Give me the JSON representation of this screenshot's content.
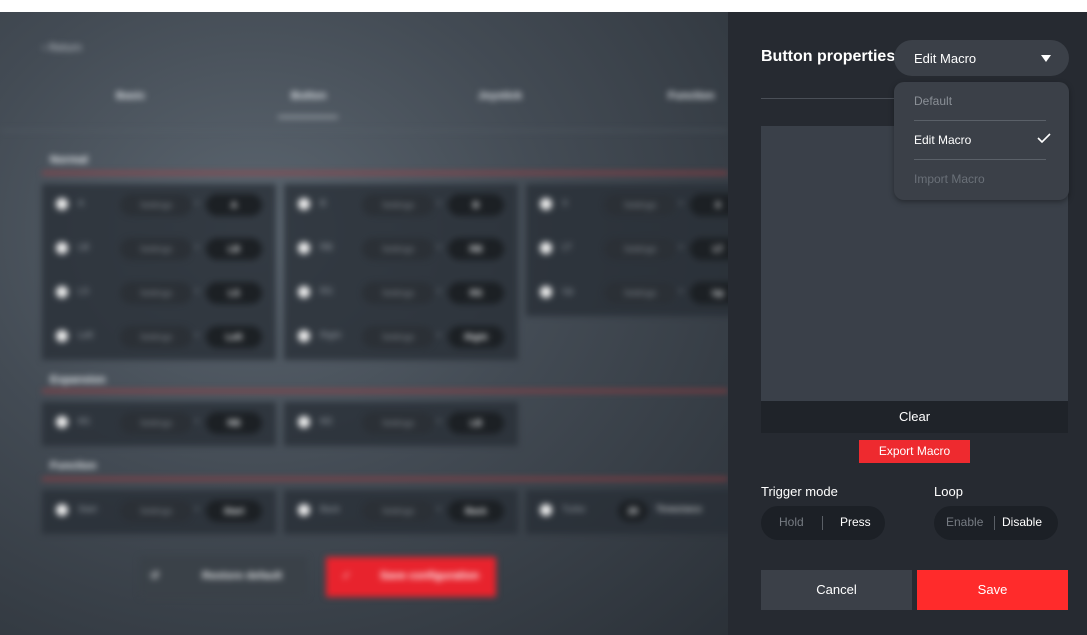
{
  "background": {
    "return_label": "Return",
    "tabs": [
      "Basic",
      "Button",
      "Joystick",
      "Function"
    ],
    "sections": {
      "normal": "Normal",
      "expansion": "Expansion",
      "function": "Function"
    },
    "rows": {
      "normal_col1": [
        {
          "name": "A",
          "setting": "Settings",
          "value": "A"
        },
        {
          "name": "LB",
          "setting": "Settings",
          "value": "LB"
        },
        {
          "name": "LS",
          "setting": "Settings",
          "value": "LS"
        },
        {
          "name": "Left",
          "setting": "Settings",
          "value": "Left"
        }
      ],
      "normal_col2": [
        {
          "name": "B",
          "setting": "Settings",
          "value": "B"
        },
        {
          "name": "RB",
          "setting": "Settings",
          "value": "RB"
        },
        {
          "name": "RS",
          "setting": "Settings",
          "value": "RS"
        },
        {
          "name": "Right",
          "setting": "Settings",
          "value": "Right"
        }
      ],
      "normal_col3": [
        {
          "name": "X",
          "setting": "Settings",
          "value": "X"
        },
        {
          "name": "LT",
          "setting": "Settings",
          "value": "LT"
        },
        {
          "name": "Up",
          "setting": "Settings",
          "value": "Up"
        }
      ],
      "expansion": [
        {
          "name": "M1",
          "setting": "Settings",
          "value": "RB"
        },
        {
          "name": "M2",
          "setting": "Settings",
          "value": "LB"
        }
      ],
      "function": [
        {
          "name": "Start",
          "setting": "Settings",
          "value": "Start"
        },
        {
          "name": "Back",
          "setting": "Settings",
          "value": "Back"
        }
      ],
      "turbo": {
        "name": "Turbo",
        "value": "20",
        "unit": "Times/seco"
      }
    },
    "restore_label": "Restore default",
    "save_config_label": "Save configuration"
  },
  "panel": {
    "title": "Button properties",
    "select_value": "Edit Macro",
    "dropdown": {
      "items": [
        {
          "label": "Default",
          "state": "normal"
        },
        {
          "label": "Edit Macro",
          "state": "selected"
        },
        {
          "label": "Import Macro",
          "state": "disabled"
        }
      ]
    },
    "clear_label": "Clear",
    "export_label": "Export Macro",
    "trigger_mode": {
      "label": "Trigger mode",
      "options": [
        "Hold",
        "Press"
      ],
      "selected": "Press"
    },
    "loop": {
      "label": "Loop",
      "options": [
        "Enable",
        "Disable"
      ],
      "selected": "Disable"
    },
    "cancel_label": "Cancel",
    "save_label": "Save"
  },
  "colors": {
    "accent_red": "#ff2b2b",
    "panel_bg": "#262a31",
    "control_bg": "#3b4048"
  }
}
